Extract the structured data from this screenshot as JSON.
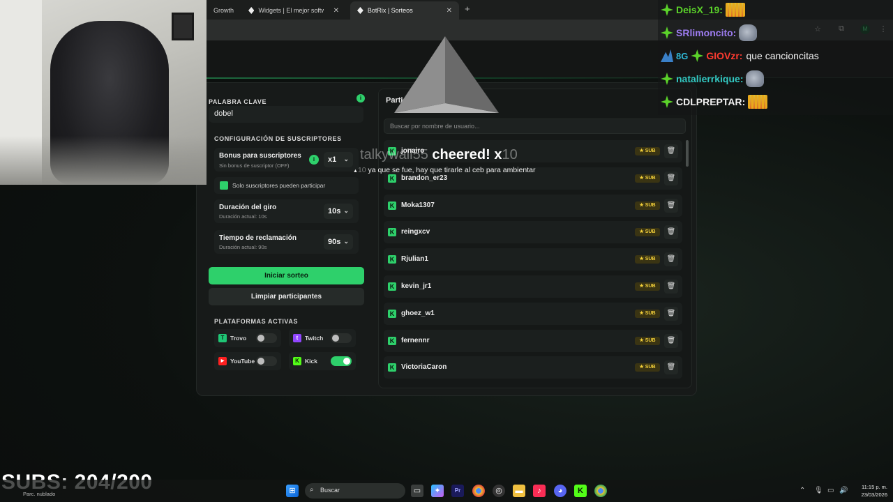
{
  "browser": {
    "tabs": [
      {
        "label": "Growth",
        "active": false
      },
      {
        "label": "Widgets | El mejor software pa",
        "active": false
      },
      {
        "label": "BotRix | Sorteos",
        "active": true
      }
    ],
    "new_tab": "+",
    "close_glyph": "✕"
  },
  "left": {
    "keyword_title": "PALABRA CLAVE",
    "keyword_value": "dobel",
    "info_glyph": "i",
    "subs_title": "CONFIGURACIÓN DE SUSCRIPTORES",
    "bonus_title": "Bonus para suscriptores",
    "bonus_sub": "Sin bonus de suscriptor (OFF)",
    "bonus_value": "x1",
    "only_subs_label": "Solo suscriptores pueden participar",
    "spin_title": "Duración del giro",
    "spin_sub": "Duración actual: 10s",
    "spin_value": "10s",
    "claim_title": "Tiempo de reclamación",
    "claim_sub": "Duración actual: 90s",
    "claim_value": "90s",
    "start_button": "Iniciar sorteo",
    "clear_button": "Limpiar participantes",
    "platforms_title": "PLATAFORMAS ACTIVAS",
    "platforms": [
      {
        "name": "Trovo",
        "on": false,
        "color": "#1fc675"
      },
      {
        "name": "Twitch",
        "on": false,
        "color": "#9146ff"
      },
      {
        "name": "YouTube",
        "on": false,
        "color": "#ff2020"
      },
      {
        "name": "Kick",
        "on": true,
        "color": "#53fc18"
      }
    ]
  },
  "participants": {
    "title": "Partici",
    "search_placeholder": "Buscar por nombre de usuario...",
    "sub_label": "★ SUB",
    "trash_glyph": "🗑",
    "kick_glyph": "K",
    "users": [
      "jonairo",
      "brandon_er23",
      "Moka1307",
      "reingxcv",
      "Rjulian1",
      "kevin_jr1",
      "ghoez_w1",
      "fernennr",
      "VictoriaCaron"
    ]
  },
  "cheer": {
    "user": "talkywall55",
    "message": "cheered! x",
    "amount": "10",
    "line_amount": "10",
    "line_text": " ya que se fue, hay que tirarle al ceb para ambientar"
  },
  "chat": [
    {
      "user": "DeisX_19:",
      "color": "#5bd22a",
      "text": "",
      "emote": "bars"
    },
    {
      "user": "SRlimoncito:",
      "color": "#9d7cf0",
      "text": "",
      "emote": "pig"
    },
    {
      "user": "GIOVzr:",
      "color": "#ff3b30",
      "text": "que cancioncitas",
      "emote": ""
    },
    {
      "user": "natalierrkique:",
      "color": "#33c9c3",
      "text": "",
      "emote": "pig"
    },
    {
      "user": "CDLPREPTAR:",
      "color": "#f2f2f2",
      "text": "",
      "emote": "bars"
    }
  ],
  "chat_bits": "8G",
  "subs_counter": "SUBS: 204/200",
  "taskbar": {
    "search": "Buscar",
    "weather": "Parc. nublado",
    "time": "11:15 p. m.",
    "date": "23/03/2026"
  },
  "colors": {
    "accent": "#2ed06b",
    "sub_badge": "#f2cf3a"
  }
}
